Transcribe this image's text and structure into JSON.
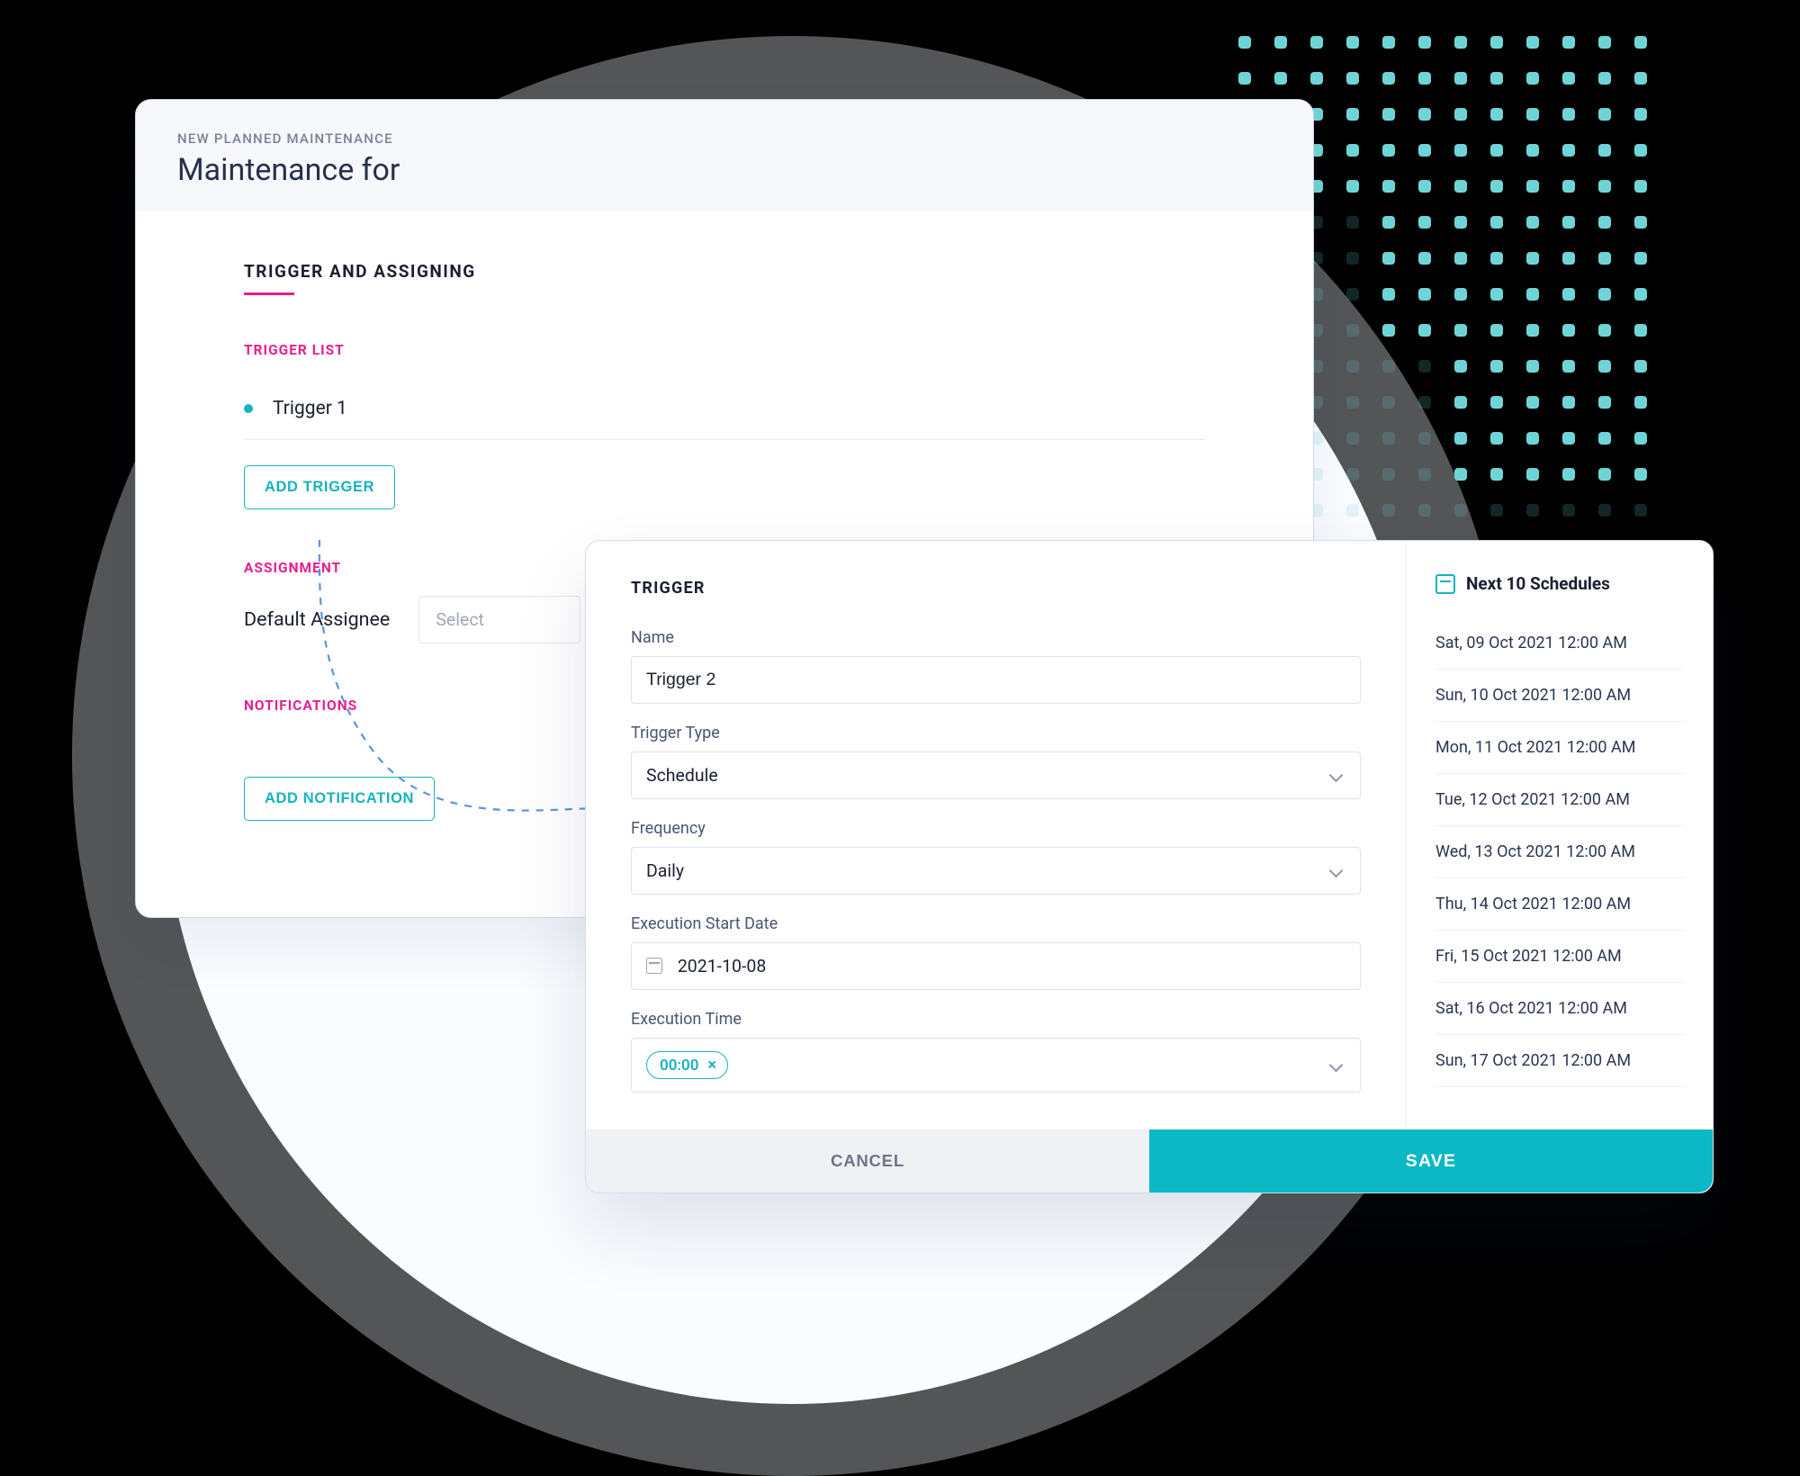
{
  "back": {
    "eyebrow": "NEW PLANNED MAINTENANCE",
    "title": "Maintenance for",
    "section_title": "TRIGGER AND ASSIGNING",
    "trigger_list_label": "TRIGGER LIST",
    "triggers": [
      {
        "name": "Trigger 1"
      }
    ],
    "add_trigger": "ADD TRIGGER",
    "assignment_label": "ASSIGNMENT",
    "default_assignee_label": "Default Assignee",
    "assignee_placeholder": "Select",
    "notifications_label": "NOTIFICATIONS",
    "add_notification": "ADD NOTIFICATION"
  },
  "front": {
    "panel_title": "TRIGGER",
    "name_label": "Name",
    "name_value": "Trigger 2",
    "type_label": "Trigger Type",
    "type_value": "Schedule",
    "freq_label": "Frequency",
    "freq_value": "Daily",
    "start_label": "Execution Start Date",
    "start_value": "2021-10-08",
    "time_label": "Execution Time",
    "time_chip": "00:00",
    "cancel": "CANCEL",
    "save": "SAVE"
  },
  "schedules": {
    "title": "Next 10 Schedules",
    "items": [
      "Sat, 09 Oct 2021 12:00 AM",
      "Sun, 10 Oct 2021 12:00 AM",
      "Mon, 11 Oct 2021 12:00 AM",
      "Tue, 12 Oct 2021 12:00 AM",
      "Wed, 13 Oct 2021 12:00 AM",
      "Thu, 14 Oct 2021 12:00 AM",
      "Fri, 15 Oct 2021 12:00 AM",
      "Sat, 16 Oct 2021 12:00 AM",
      "Sun, 17 Oct 2021 12:00 AM"
    ]
  }
}
